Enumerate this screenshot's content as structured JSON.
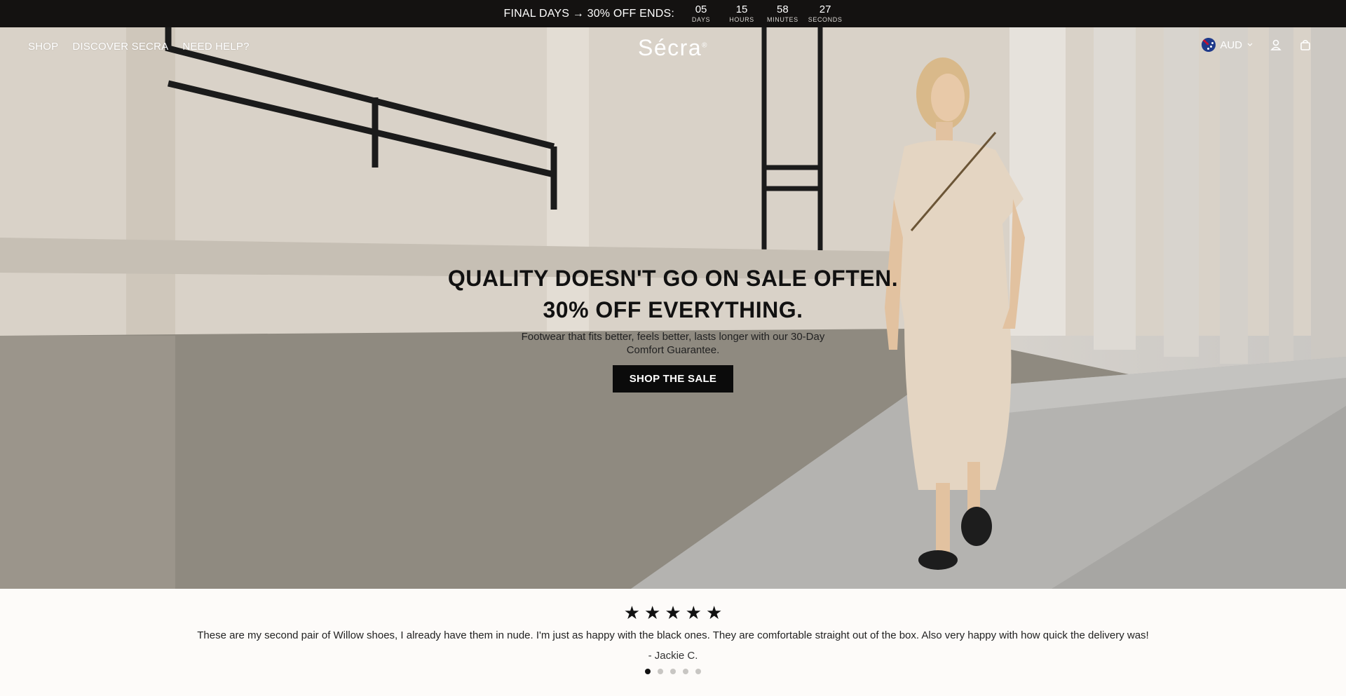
{
  "announcement": {
    "text": "FINAL DAYS → 30% OFF ENDS:",
    "countdown": [
      {
        "value": "05",
        "label": "DAYS"
      },
      {
        "value": "15",
        "label": "HOURS"
      },
      {
        "value": "58",
        "label": "MINUTES"
      },
      {
        "value": "27",
        "label": "SECONDS"
      }
    ]
  },
  "header": {
    "nav": [
      "SHOP",
      "DISCOVER SECRA",
      "NEED HELP?"
    ],
    "logo": "Sécra",
    "logo_mark": "®",
    "currency": "AUD",
    "icons": [
      "account-icon",
      "cart-icon"
    ]
  },
  "hero": {
    "headline_line1": "QUALITY DOESN'T GO ON SALE OFTEN.",
    "headline_line2": "30% OFF EVERYTHING.",
    "subtext": "Footwear that fits better, feels better, lasts longer with our 30-Day Comfort Guarantee.",
    "cta": "SHOP THE SALE"
  },
  "reviews": {
    "rating": 5,
    "quote": "These are my second pair of Willow shoes, I already have them in nude. I'm just as happy with the black ones. They are comfortable straight out of the box. Also very happy with how quick the delivery was!",
    "author": "- Jackie C.",
    "slide_count": 5,
    "active_slide": 1
  },
  "colors": {
    "announcement_bg": "#141211",
    "cta_bg": "#0b0b0b",
    "page_bg": "#fdfbf9"
  }
}
